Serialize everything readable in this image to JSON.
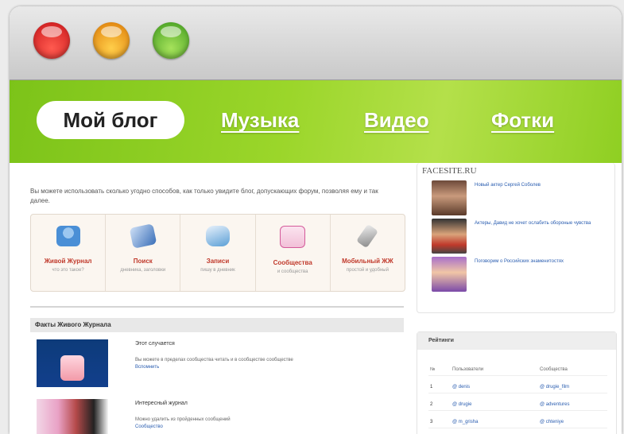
{
  "nav": {
    "tabs": [
      {
        "label": "Мой блог",
        "active": true
      },
      {
        "label": "Музыка"
      },
      {
        "label": "Видео"
      },
      {
        "label": "Фотки"
      }
    ]
  },
  "main": {
    "intro": "Вы можете использовать сколько угодно способов, как только увидите блог, допускающих форум, позволяя ему и так далее.",
    "features": [
      {
        "title": "Живой Журнал",
        "sub": "что это такое?",
        "icon": "person-icon",
        "color": "#4a8fd6"
      },
      {
        "title": "Поиск",
        "sub": "дневника, заголовки",
        "icon": "card-icon",
        "color": "#3a6fb8"
      },
      {
        "title": "Записи",
        "sub": "пишу в дневник",
        "icon": "disk-icon",
        "color": "#5a9fd6"
      },
      {
        "title": "Сообщества",
        "sub": "и сообщества",
        "icon": "chat-icon",
        "color": "#d45a9a"
      },
      {
        "title": "Мобильный ЖЖ",
        "sub": "простой и удобный",
        "icon": "phone-icon",
        "color": "#8a8a8a"
      }
    ],
    "section_title": "Факты Живого Журнала",
    "posts": [
      {
        "title": "Этот случается",
        "text": "Вы можете в пределах сообщества читать и в сообществе сообществе",
        "link": "Вспомнить"
      },
      {
        "title": "Интересный журнал",
        "text": "Можно удалить из пройденных сообщений",
        "link": "Сообщество"
      }
    ]
  },
  "sidebar": {
    "box_title": "FACESITE.RU",
    "items": [
      {
        "text": "Новый актер Сергей Соболев"
      },
      {
        "text": "Актеры, Давид не хочет ослабить обороные чувства"
      },
      {
        "text": "Поговорим о Российских знаменитостях"
      }
    ],
    "rating": {
      "title": "Рейтинги",
      "headers": [
        "№",
        "Пользователи",
        "Сообщества"
      ],
      "rows": [
        {
          "n": "1",
          "user": "@ denis",
          "community": "@ drugie_film"
        },
        {
          "n": "2",
          "user": "@ drugie",
          "community": "@ adventures"
        },
        {
          "n": "3",
          "user": "@ m_grisha",
          "community": "@ chteniye"
        }
      ]
    }
  }
}
